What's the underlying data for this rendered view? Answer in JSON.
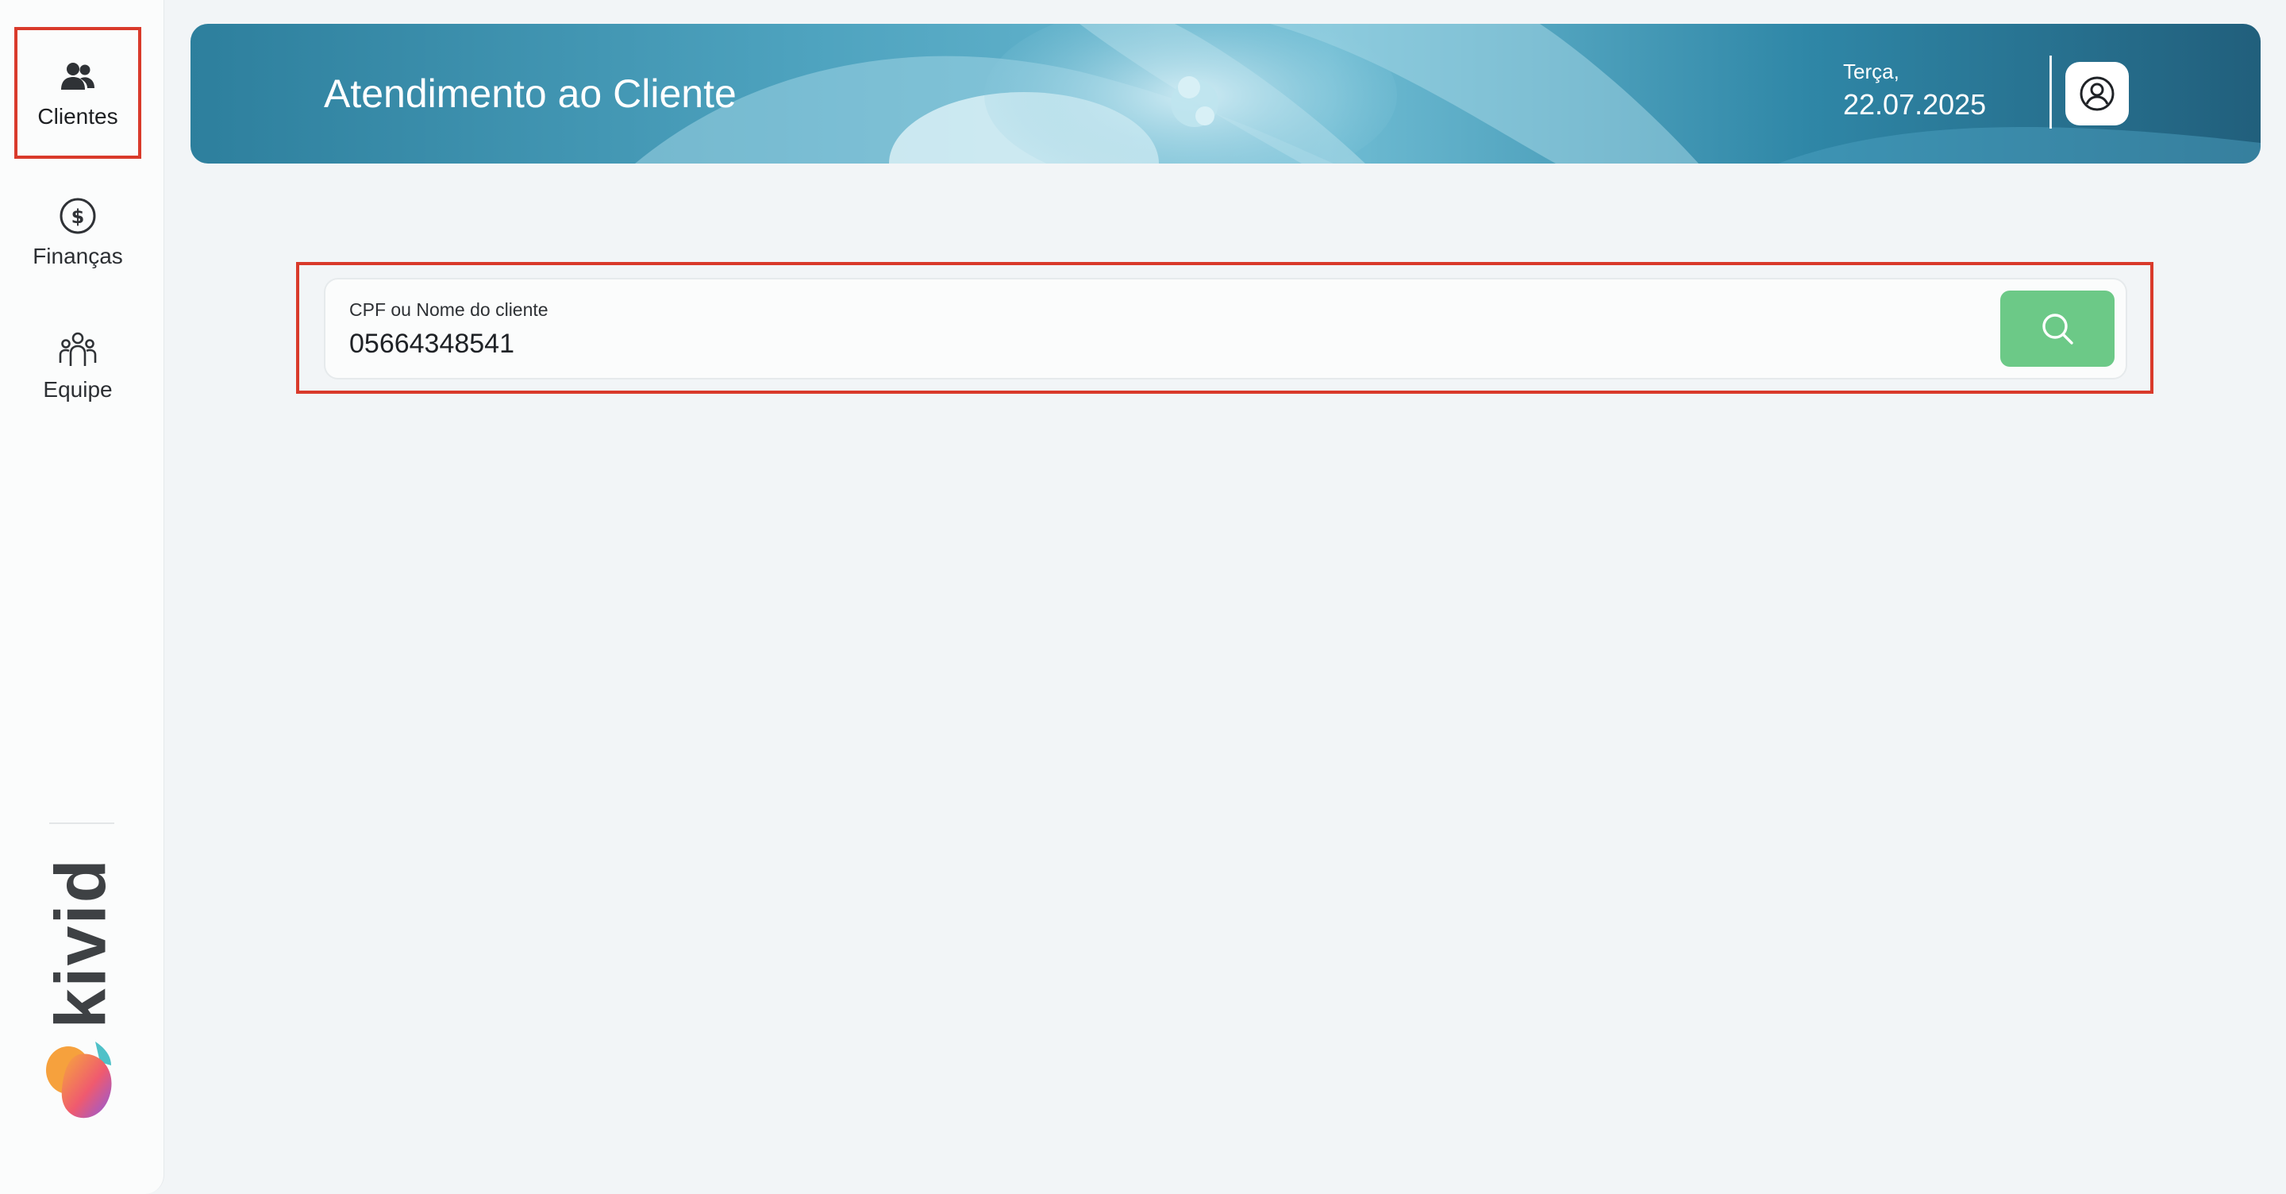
{
  "sidebar": {
    "items": [
      {
        "label": "Clientes",
        "icon": "users-icon",
        "active": true
      },
      {
        "label": "Finanças",
        "icon": "dollar-circle-icon",
        "active": false
      },
      {
        "label": "Equipe",
        "icon": "team-icon",
        "active": false
      }
    ],
    "brand": "kivid"
  },
  "header": {
    "title": "Atendimento ao Cliente",
    "weekday": "Terça,",
    "date": "22.07.2025",
    "profile_icon": "user-circle-icon"
  },
  "search": {
    "label": "CPF ou Nome do cliente",
    "value": "05664348541",
    "button_icon": "search-icon",
    "button_color": "#6cc987"
  },
  "colors": {
    "highlight": "#d93a2b",
    "header_teal": "#2f7f9e",
    "background": "#f2f5f7"
  }
}
